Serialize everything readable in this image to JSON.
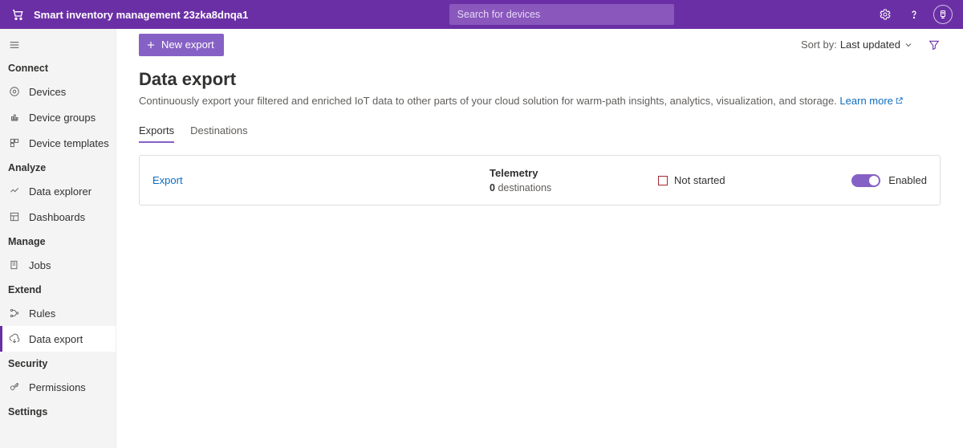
{
  "header": {
    "app_title": "Smart inventory management 23zka8dnqa1",
    "search_placeholder": "Search for devices"
  },
  "sidebar": {
    "sections": [
      {
        "label": "Connect",
        "items": [
          {
            "id": "devices",
            "label": "Devices"
          },
          {
            "id": "device-groups",
            "label": "Device groups"
          },
          {
            "id": "device-templates",
            "label": "Device templates"
          }
        ]
      },
      {
        "label": "Analyze",
        "items": [
          {
            "id": "data-explorer",
            "label": "Data explorer"
          },
          {
            "id": "dashboards",
            "label": "Dashboards"
          }
        ]
      },
      {
        "label": "Manage",
        "items": [
          {
            "id": "jobs",
            "label": "Jobs"
          }
        ]
      },
      {
        "label": "Extend",
        "items": [
          {
            "id": "rules",
            "label": "Rules"
          },
          {
            "id": "data-export",
            "label": "Data export",
            "active": true
          }
        ]
      },
      {
        "label": "Security",
        "items": [
          {
            "id": "permissions",
            "label": "Permissions"
          }
        ]
      },
      {
        "label": "Settings",
        "items": []
      }
    ]
  },
  "toolbar": {
    "new_export_label": "New export",
    "sort_by_prefix": "Sort by:",
    "sort_by_value": "Last updated"
  },
  "page": {
    "title": "Data export",
    "description": "Continuously export your filtered and enriched IoT data to other parts of your cloud solution for warm-path insights, analytics, visualization, and storage.",
    "learn_more": "Learn more"
  },
  "tabs": [
    {
      "id": "exports",
      "label": "Exports",
      "active": true
    },
    {
      "id": "destinations",
      "label": "Destinations"
    }
  ],
  "exports": [
    {
      "name": "Export",
      "telemetry_title": "Telemetry",
      "destinations_count": "0",
      "destinations_word": "destinations",
      "status": "Not started",
      "enabled_label": "Enabled",
      "enabled": true
    }
  ]
}
